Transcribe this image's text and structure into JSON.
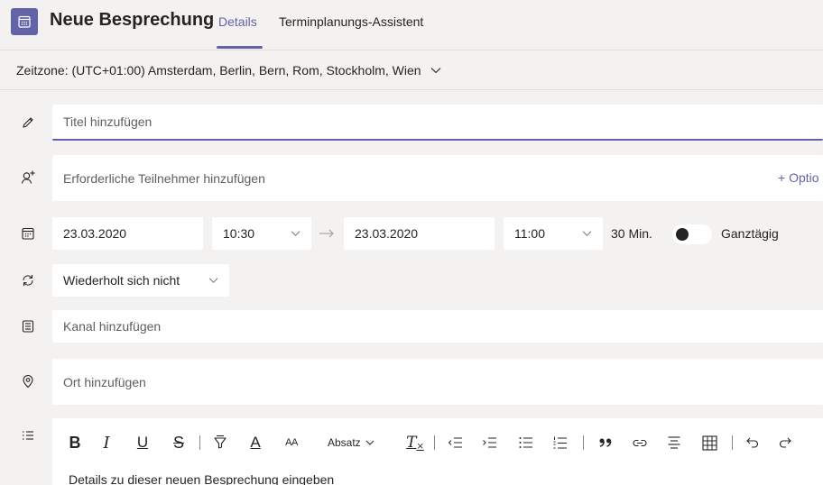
{
  "header": {
    "title": "Neue Besprechung",
    "tabs": [
      {
        "label": "Details",
        "active": true
      },
      {
        "label": "Terminplanungs-Assistent",
        "active": false
      }
    ]
  },
  "timezone": {
    "label": "Zeitzone: (UTC+01:00) Amsterdam, Berlin, Bern, Rom, Stockholm, Wien"
  },
  "form": {
    "title_placeholder": "Titel hinzufügen",
    "attendees_placeholder": "Erforderliche Teilnehmer hinzufügen",
    "optional_label": "+ Optio",
    "start_date": "23.03.2020",
    "start_time": "10:30",
    "end_date": "23.03.2020",
    "end_time": "11:00",
    "duration": "30 Min.",
    "all_day_label": "Ganztägig",
    "all_day_on": false,
    "recurrence": "Wiederholt sich nicht",
    "channel_placeholder": "Kanal hinzufügen",
    "location_placeholder": "Ort hinzufügen"
  },
  "editor": {
    "paragraph_label": "Absatz",
    "placeholder": "Details zu dieser neuen Besprechung eingeben",
    "toolbar": {
      "bold": "B",
      "italic": "I",
      "underline": "U",
      "strike": "S",
      "font_color": "A",
      "font_size": "AA",
      "clear_format": "T"
    }
  },
  "colors": {
    "accent": "#6264a7",
    "background": "#f3f2f1",
    "field": "#ffffff",
    "text": "#252423"
  }
}
